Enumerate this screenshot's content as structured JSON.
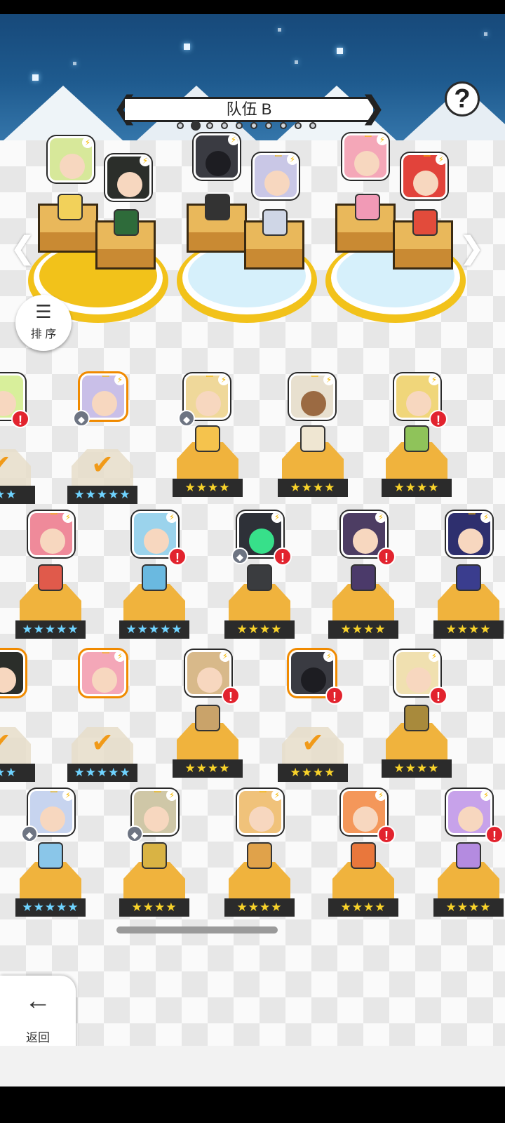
{
  "team": {
    "title": "队伍 B",
    "page_count": 10,
    "active_page": 2
  },
  "help": {
    "icon": "question-icon",
    "label": "?"
  },
  "sort": {
    "label": "排 序",
    "icon": "sort-icon"
  },
  "back": {
    "label": "返回",
    "icon": "arrow-left-icon"
  },
  "colors": {
    "accent": "#f2c21a",
    "warn": "#e2232e",
    "sky": "#1e5a8e"
  },
  "formation": {
    "slots": [
      {
        "ring": "#f2c21a"
      },
      {
        "ring": "#d6f0fb"
      },
      {
        "ring": "#d6f0fb"
      }
    ]
  },
  "roster": {
    "rows": [
      [
        {
          "stars": "★★★",
          "blue": true,
          "check": true
        },
        {
          "stars": "★★★★★",
          "blue": true,
          "check": true
        },
        {
          "stars": "★★★★"
        },
        {
          "stars": "★★★★"
        },
        {
          "stars": "★★★★"
        }
      ],
      [
        {
          "stars": "★★★★★",
          "blue": true
        },
        {
          "stars": "★★★★★",
          "blue": true
        },
        {
          "stars": "★★★★"
        },
        {
          "stars": "★★★★"
        },
        {
          "stars": "★★★★"
        }
      ],
      [
        {
          "stars": "★★★",
          "blue": true,
          "check": true
        },
        {
          "stars": "★★★★★",
          "blue": true,
          "check": true
        },
        {
          "stars": "★★★★"
        },
        {
          "stars": "★★★★",
          "check": true
        },
        {
          "stars": "★★★★"
        }
      ],
      [
        {
          "stars": "★★★★★",
          "blue": true
        },
        {
          "stars": "★★★★"
        },
        {
          "stars": "★★★★"
        },
        {
          "stars": "★★★★"
        },
        {
          "stars": "★★★★"
        }
      ]
    ]
  }
}
